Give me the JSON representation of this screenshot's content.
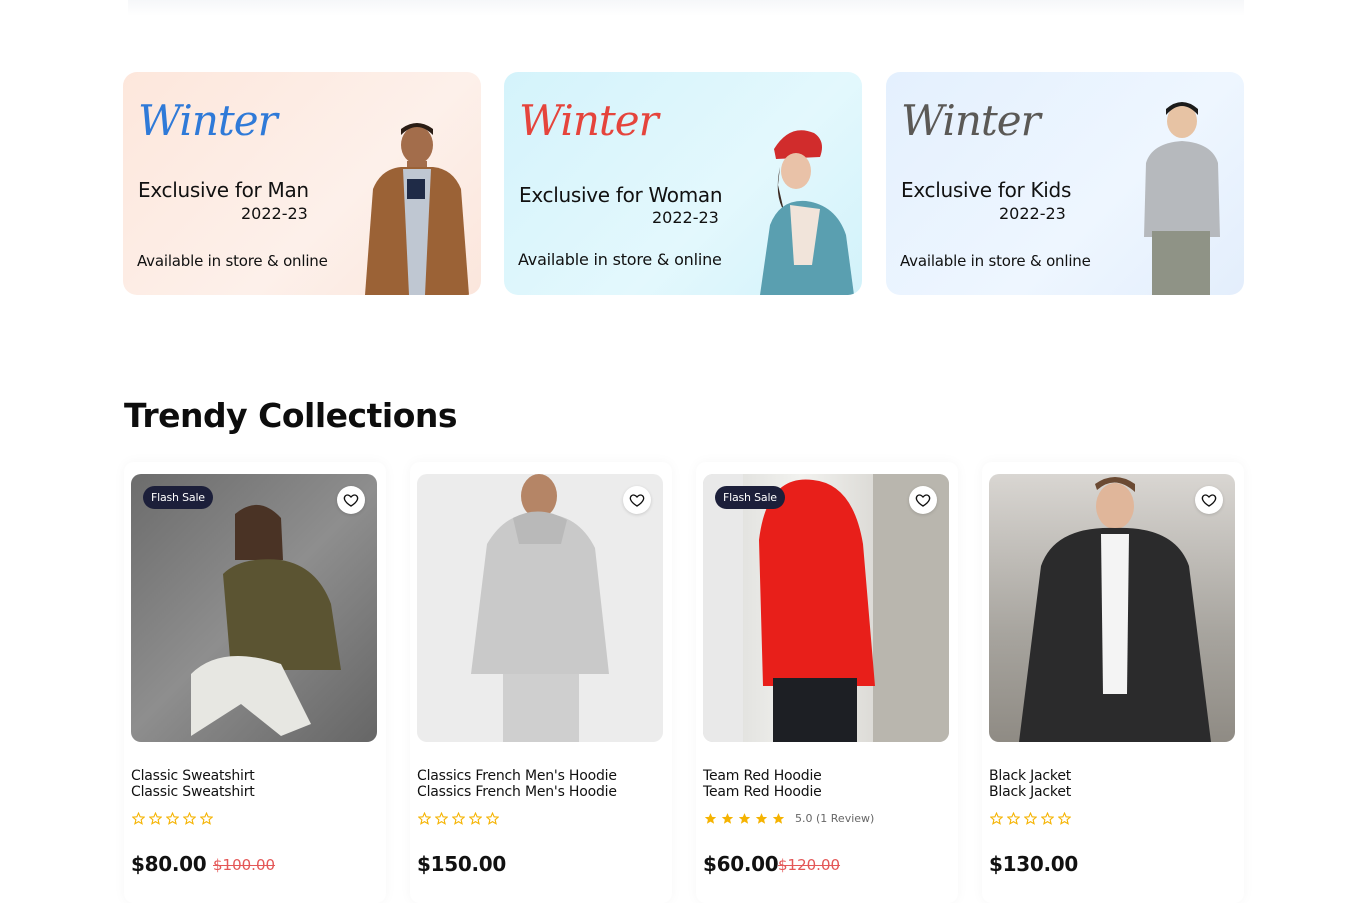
{
  "banners": [
    {
      "script": "Winter",
      "title": "Exclusive for Man",
      "year": "2022-23",
      "availability": "Available in store & online"
    },
    {
      "script": "Winter",
      "title": "Exclusive for Woman",
      "year": "2022-23",
      "availability": "Available in store & online"
    },
    {
      "script": "Winter",
      "title": "Exclusive for Kids",
      "year": "2022-23",
      "availability": "Available in store & online"
    }
  ],
  "section": {
    "title": "Trendy Collections"
  },
  "products": [
    {
      "badge": "Flash Sale",
      "name": "Classic Sweatshirt",
      "subname": "Classic Sweatshirt",
      "price": "$80.00",
      "old_price": "$100.00",
      "rating": 0,
      "review": ""
    },
    {
      "badge": "",
      "name": "Classics French Men's Hoodie",
      "subname": "Classics French Men's Hoodie",
      "price": "$150.00",
      "old_price": "",
      "rating": 0,
      "review": ""
    },
    {
      "badge": "Flash Sale",
      "name": "Team Red Hoodie",
      "subname": "Team Red Hoodie",
      "price": "$60.00",
      "old_price": "$120.00",
      "rating": 5,
      "review": "5.0 (1 Review)"
    },
    {
      "badge": "",
      "name": "Black Jacket",
      "subname": "Black Jacket",
      "price": "$130.00",
      "old_price": "",
      "rating": 0,
      "review": ""
    }
  ],
  "icons": {
    "wishlist": "heart-icon",
    "rating": "star-icon"
  },
  "colors": {
    "star": "#f5b301",
    "sale_price": "#e45858",
    "badge_bg": "#1c1f3a"
  }
}
